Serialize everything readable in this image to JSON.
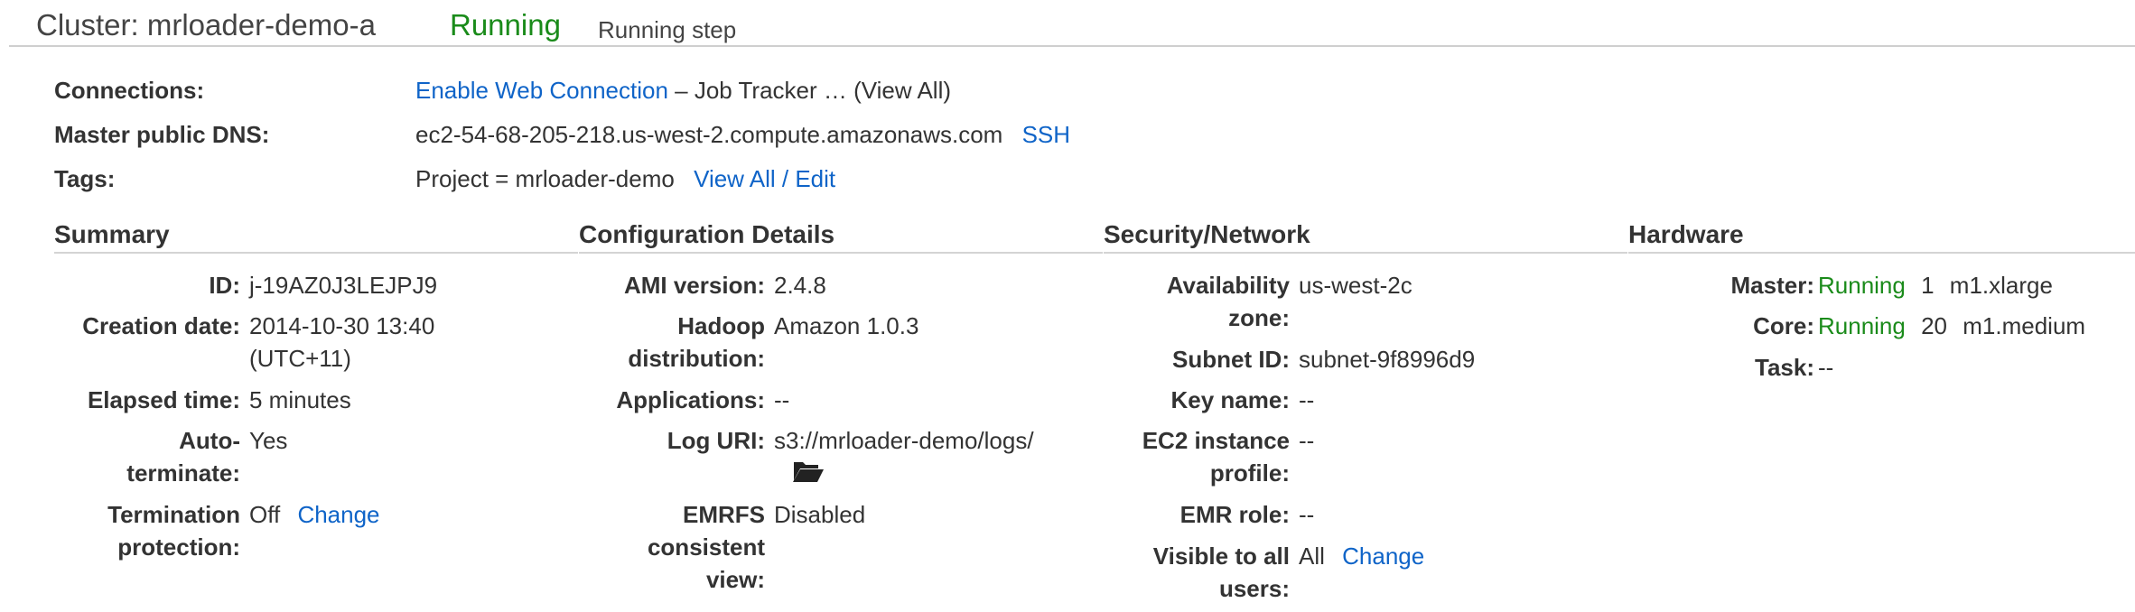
{
  "header": {
    "title": "Cluster: mrloader-demo-a",
    "status": "Running",
    "step": "Running step"
  },
  "connections": {
    "label": "Connections:",
    "link": "Enable Web Connection",
    "rest": " – Job Tracker … (View All)"
  },
  "dns": {
    "label": "Master public DNS:",
    "value": "ec2-54-68-205-218.us-west-2.compute.amazonaws.com",
    "ssh": "SSH"
  },
  "tags": {
    "label": "Tags:",
    "value": "Project = mrloader-demo",
    "edit": "View All / Edit"
  },
  "summary": {
    "heading": "Summary",
    "id_label": "ID:",
    "id": "j-19AZ0J3LEJPJ9",
    "creation_label": "Creation date:",
    "creation_1": "2014-10-30 13:40",
    "creation_2": "(UTC+11)",
    "elapsed_label": "Elapsed time:",
    "elapsed": "5 minutes",
    "auto_1": "Auto-",
    "auto_2": "terminate:",
    "auto": "Yes",
    "term_1": "Termination",
    "term_2": "protection:",
    "term": "Off",
    "change": "Change"
  },
  "config": {
    "heading": "Configuration Details",
    "ami_label": "AMI version:",
    "ami": "2.4.8",
    "hadoop_1": "Hadoop",
    "hadoop_2": "distribution:",
    "hadoop": "Amazon 1.0.3",
    "apps_label": "Applications:",
    "apps": "--",
    "log_label": "Log URI:",
    "log": "s3://mrloader-demo/logs/",
    "emrfs_1": "EMRFS",
    "emrfs_2": "consistent",
    "emrfs_3": "view:",
    "emrfs": "Disabled"
  },
  "security": {
    "heading": "Security/Network",
    "az_1": "Availability",
    "az_2": "zone:",
    "az": "us-west-2c",
    "subnet_label": "Subnet ID:",
    "subnet": "subnet-9f8996d9",
    "key_label": "Key name:",
    "key": "--",
    "ec2_1": "EC2 instance",
    "ec2_2": "profile:",
    "ec2": "--",
    "emr_label": "EMR role:",
    "emr": "--",
    "vis_1": "Visible to all",
    "vis_2": "users:",
    "vis": "All",
    "change": "Change"
  },
  "hardware": {
    "heading": "Hardware",
    "master_label": "Master:",
    "master_status": "Running",
    "master_count": "1",
    "master_type": "m1.xlarge",
    "core_label": "Core:",
    "core_status": "Running",
    "core_count": "20",
    "core_type": "m1.medium",
    "task_label": "Task:",
    "task": "--"
  },
  "colors": {
    "link": "#0f64c8",
    "running": "#1a8b1a"
  },
  "icons": {
    "log_folder": "folder-open-icon"
  }
}
